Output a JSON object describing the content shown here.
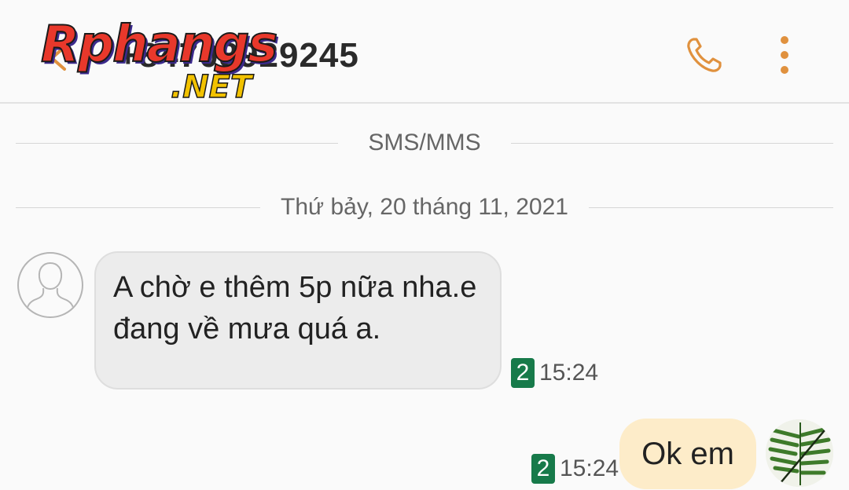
{
  "header": {
    "contact_number": "+84708929245",
    "watermark": {
      "main": "Rphangs",
      "suffix": ".NET"
    },
    "call_icon": "phone-icon",
    "more_icon": "more-vert-icon",
    "accent_color": "#e0913e"
  },
  "thread": {
    "channel_label": "SMS/MMS",
    "date_label": "Thứ bảy, 20 tháng 11, 2021"
  },
  "messages": [
    {
      "direction": "incoming",
      "text": "A chờ e thêm 5p nữa nha.e đang về mưa quá a.",
      "sim": "2",
      "time": "15:24"
    },
    {
      "direction": "outgoing",
      "text": "Ok em",
      "sim": "2",
      "time": "15:24"
    }
  ],
  "colors": {
    "incoming_bubble": "#ececec",
    "outgoing_bubble": "#fdecc9",
    "sim_badge": "#177a4a"
  }
}
